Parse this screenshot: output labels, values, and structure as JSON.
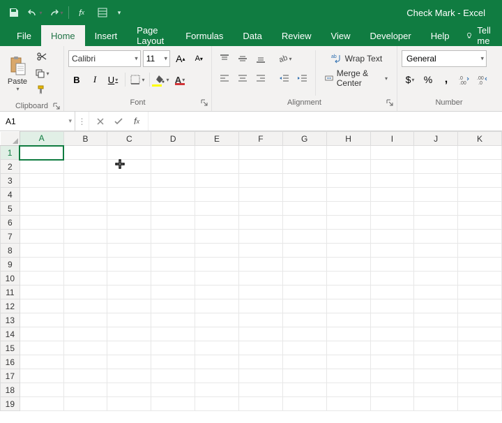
{
  "title": "Check Mark  -  Excel",
  "tabs": [
    "File",
    "Home",
    "Insert",
    "Page Layout",
    "Formulas",
    "Data",
    "Review",
    "View",
    "Developer",
    "Help"
  ],
  "active_tab_index": 1,
  "tellme": "Tell me",
  "ribbon": {
    "clipboard": {
      "paste": "Paste",
      "label": "Clipboard"
    },
    "font": {
      "name": "Calibri",
      "size": "11",
      "label": "Font"
    },
    "alignment": {
      "wrap": "Wrap Text",
      "merge": "Merge & Center",
      "label": "Alignment"
    },
    "number": {
      "format": "General",
      "label": "Number"
    }
  },
  "namebox": "A1",
  "formula": "",
  "columns": [
    "A",
    "B",
    "C",
    "D",
    "E",
    "F",
    "G",
    "H",
    "I",
    "J",
    "K"
  ],
  "rows": [
    "1",
    "2",
    "3",
    "4",
    "5",
    "6",
    "7",
    "8",
    "9",
    "10",
    "11",
    "12",
    "13",
    "14",
    "15",
    "16",
    "17",
    "18",
    "19"
  ],
  "active_cell": {
    "col": 0,
    "row": 0
  }
}
